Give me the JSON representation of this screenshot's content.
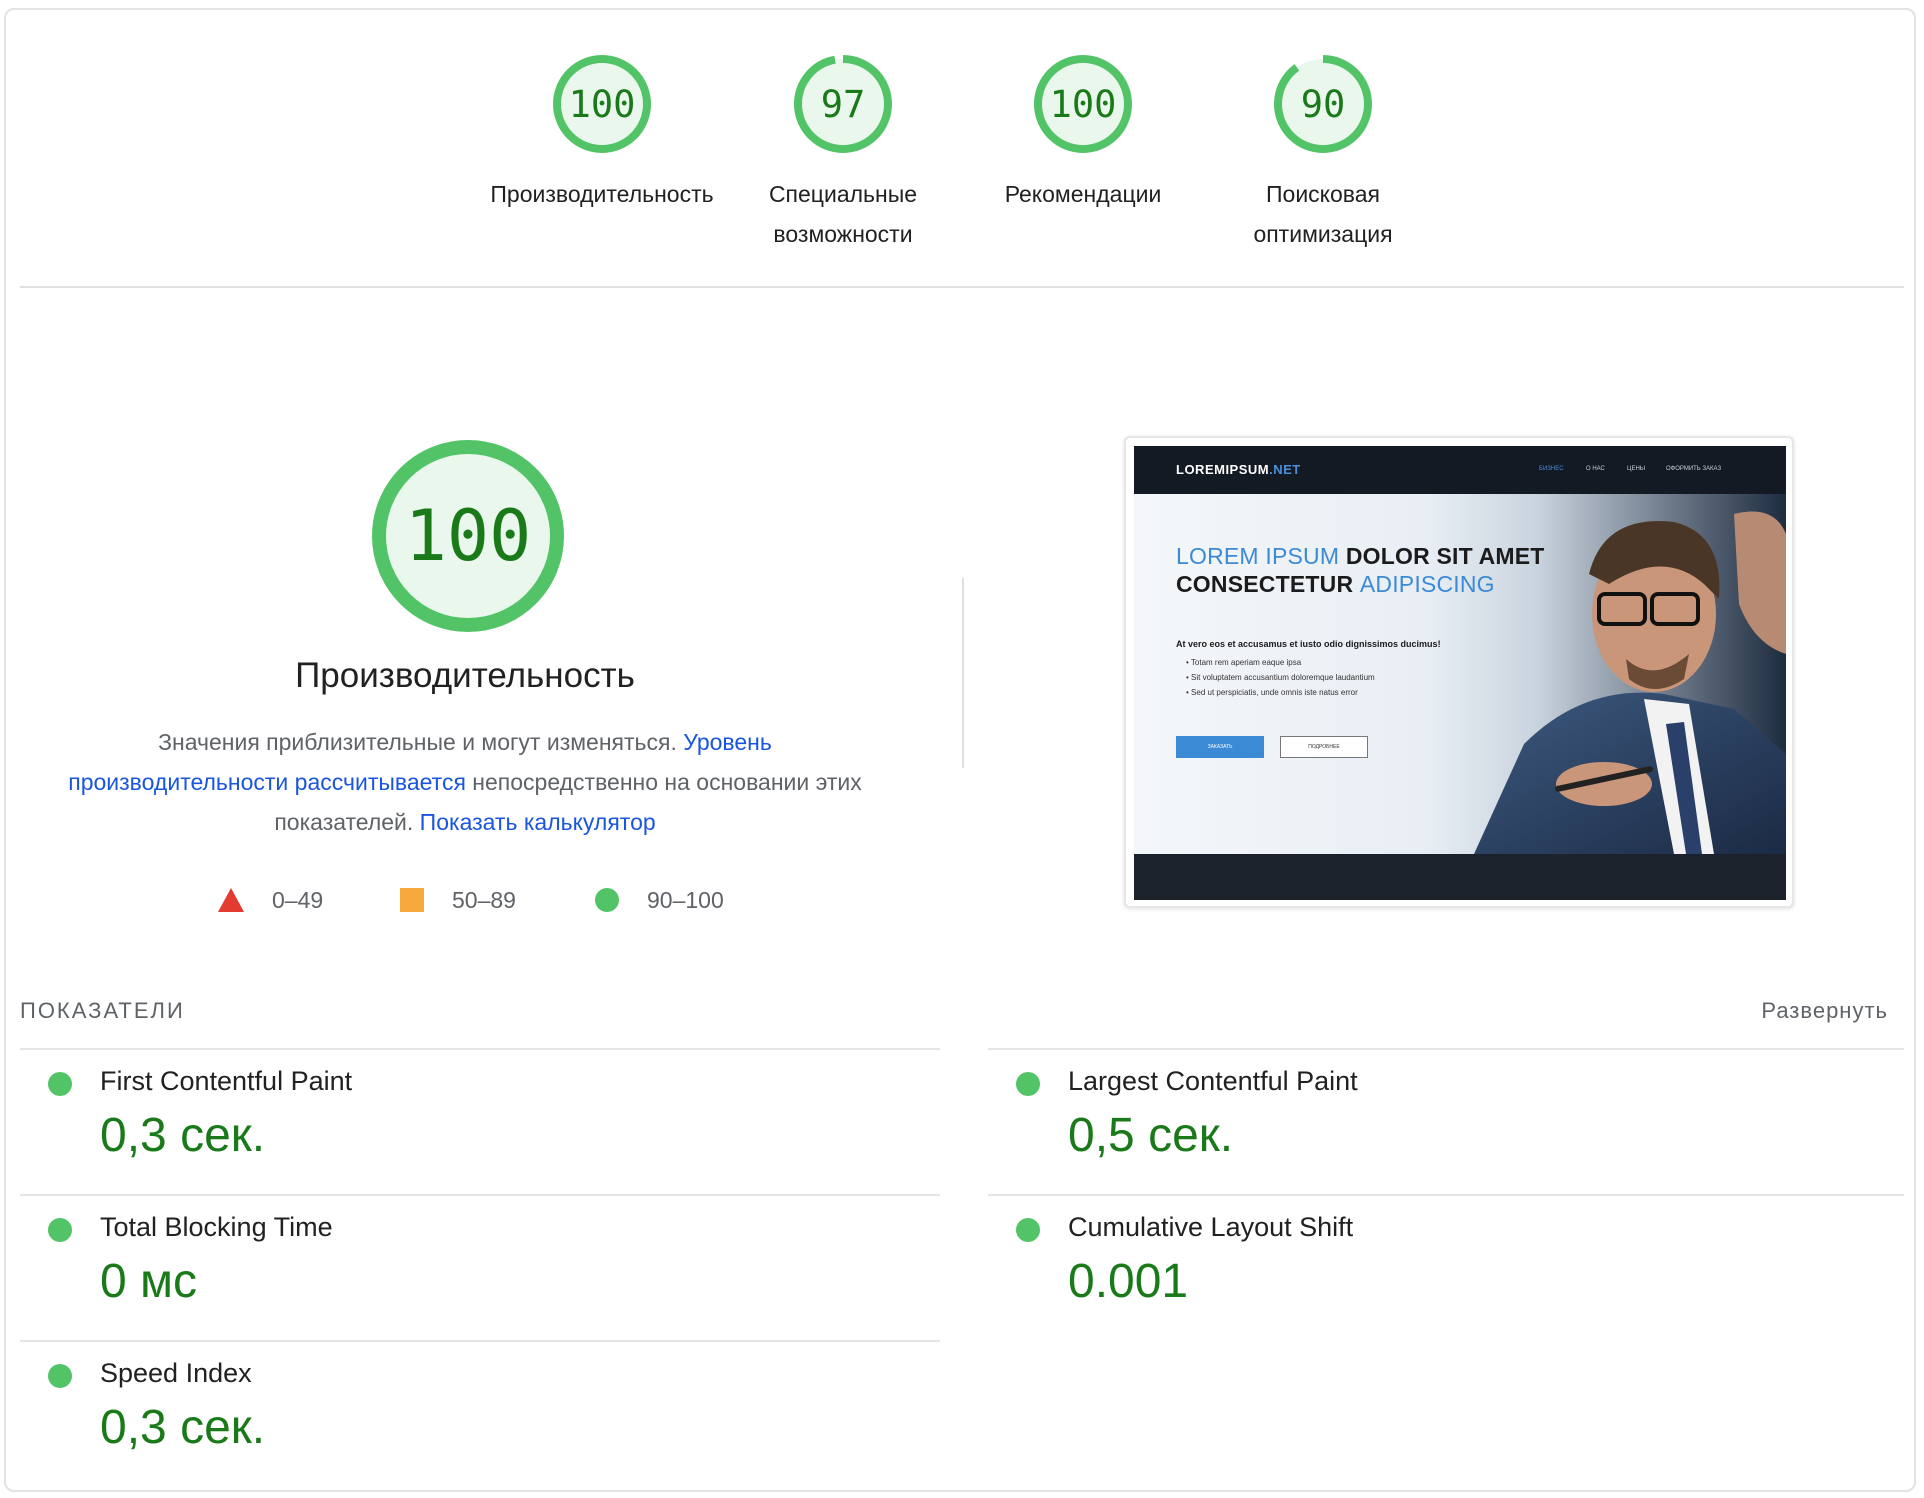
{
  "colors": {
    "pass": "#52c467",
    "pass_text": "#1a7a1a",
    "average": "#f7a93b",
    "fail": "#e33b30",
    "link": "#1a55e0"
  },
  "categories": [
    {
      "label": "Производительность",
      "score": "100",
      "value": 100
    },
    {
      "label": "Специальные возможности",
      "score": "97",
      "value": 97
    },
    {
      "label": "Рекомендации",
      "score": "100",
      "value": 100
    },
    {
      "label": "Поисковая оптимизация",
      "score": "90",
      "value": 90
    }
  ],
  "performance": {
    "score": "100",
    "value": 100,
    "title": "Производительность",
    "desc_part1": "Значения приблизительные и могут изменяться. ",
    "desc_link1": "Уровень производительности рассчитывается",
    "desc_part2": " непосредственно на основании этих показателей. ",
    "desc_link2": "Показать калькулятор"
  },
  "legend": {
    "fail": "0–49",
    "average": "50–89",
    "pass": "90–100"
  },
  "screenshot": {
    "logo_main": "LOREMIPSUM",
    "logo_accent": ".NET",
    "nav": [
      "БИЗНЕС",
      "О НАС",
      "ЦЕНЫ",
      "ОФОРМИТЬ ЗАКАЗ"
    ],
    "title_blue_1": "LOREM IPSUM",
    "title_dark_1": " DOLOR SIT AMET",
    "title_dark_2": "CONSECTETUR ",
    "title_blue_2": "ADIPISCING",
    "subtitle": "At vero eos et accusamus et iusto odio dignissimos ducimus!",
    "bullets": [
      "Totam rem aperiam eaque ipsa",
      "Sit voluptatem accusantium doloremque laudantium",
      "Sed ut perspiciatis, unde omnis iste natus error"
    ],
    "btn_primary": "ЗАКАЗАТЬ",
    "btn_secondary": "ПОДРОБНЕЕ"
  },
  "metrics": {
    "header": "ПОКАЗАТЕЛИ",
    "expand": "Развернуть",
    "items": [
      {
        "name": "First Contentful Paint",
        "value": "0,3 сек."
      },
      {
        "name": "Largest Contentful Paint",
        "value": "0,5 сек."
      },
      {
        "name": "Total Blocking Time",
        "value": "0 мс"
      },
      {
        "name": "Cumulative Layout Shift",
        "value": "0.001"
      },
      {
        "name": "Speed Index",
        "value": "0,3 сек."
      }
    ]
  }
}
